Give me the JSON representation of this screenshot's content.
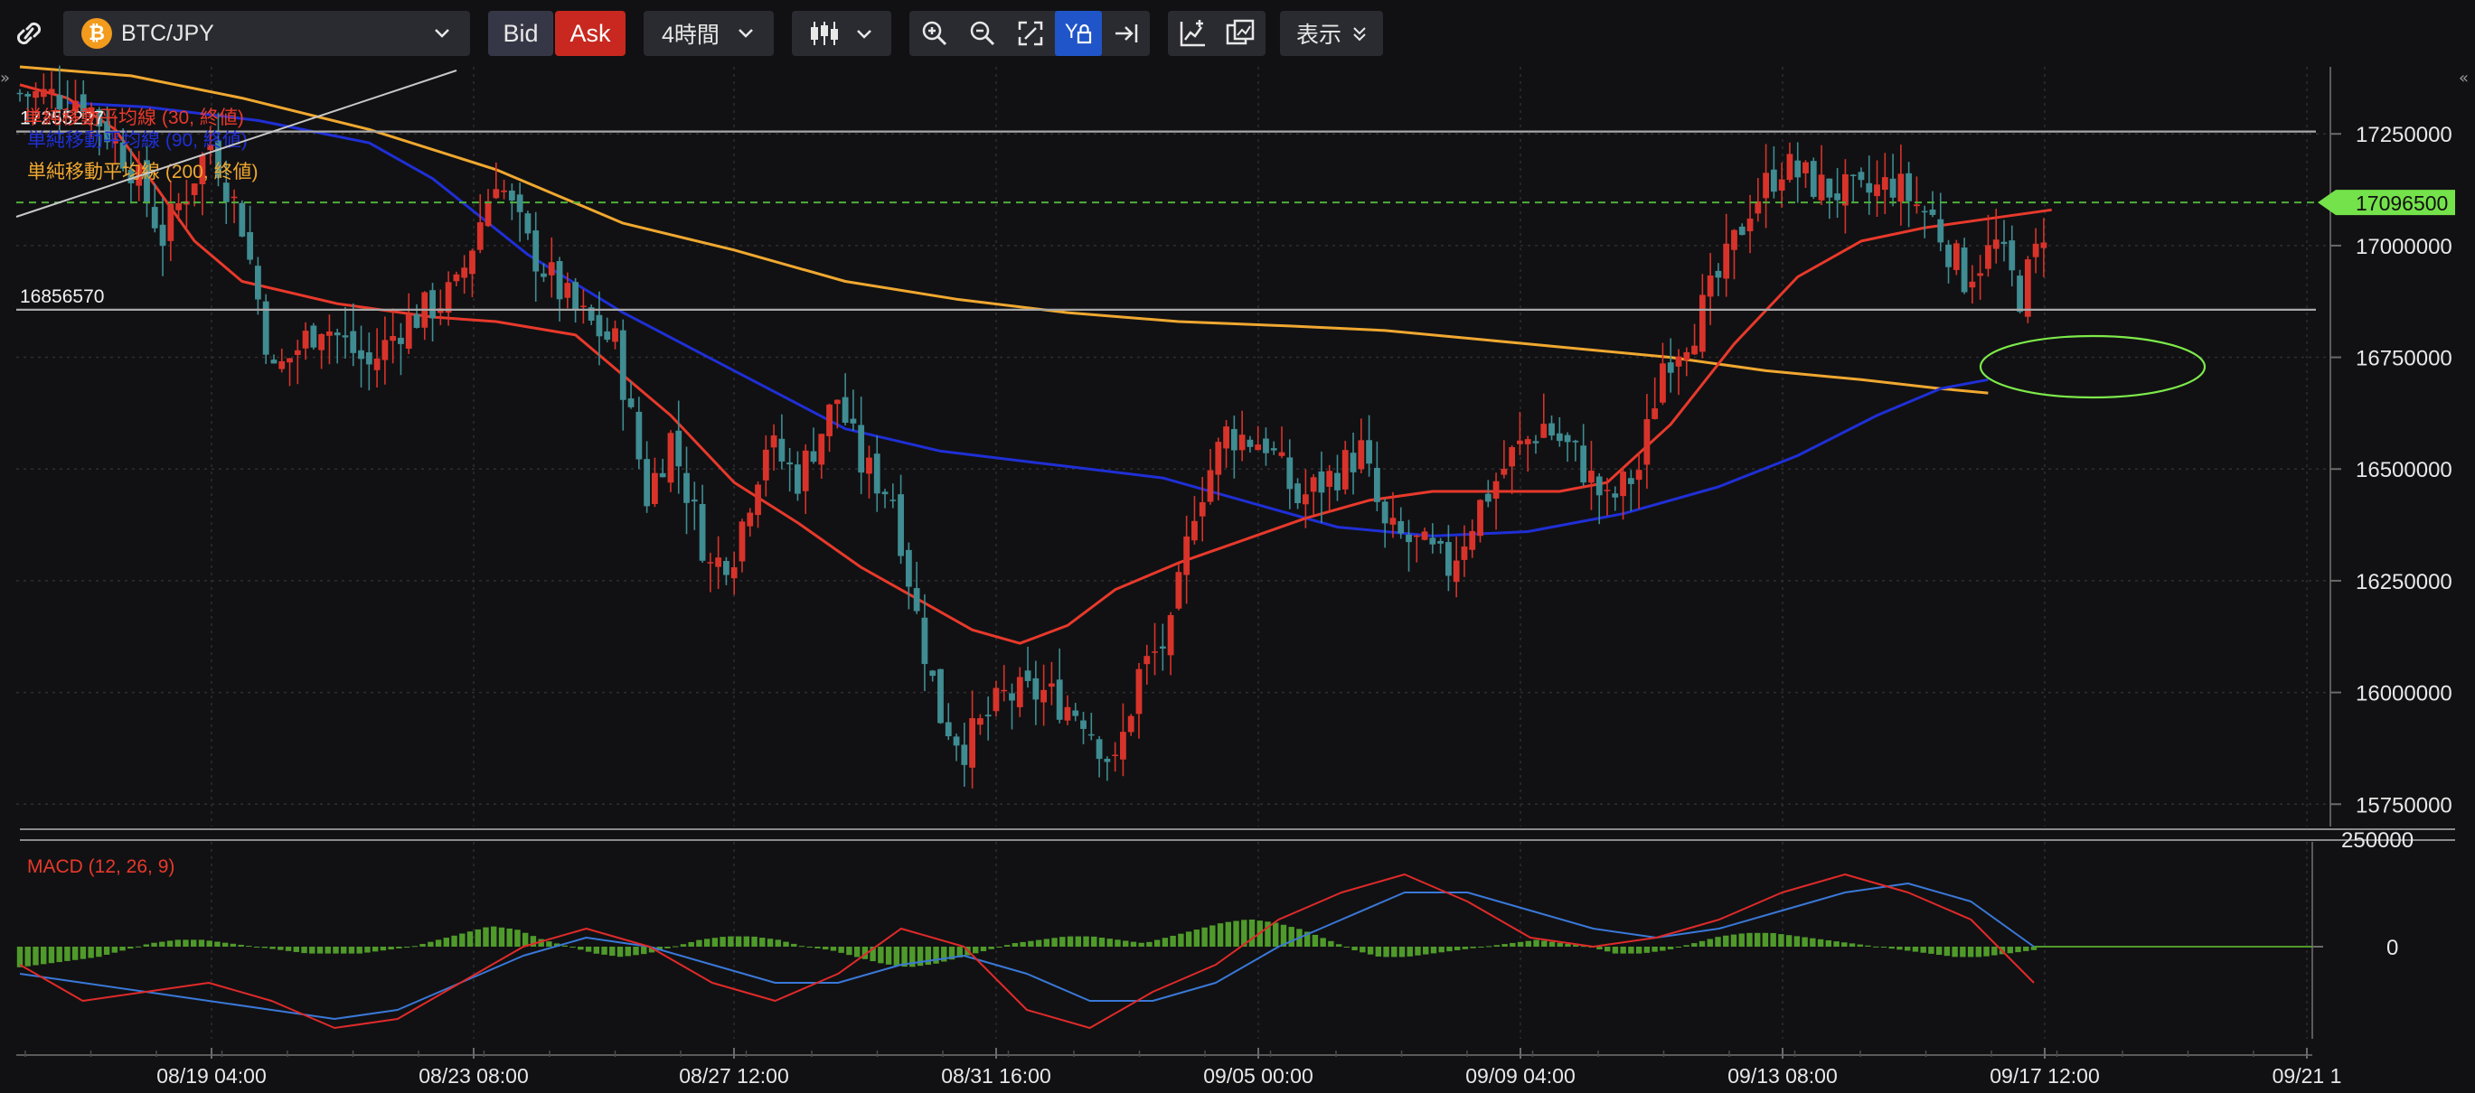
{
  "toolbar": {
    "link_icon": "link-icon",
    "symbol": "BTC/JPY",
    "symbol_coin_glyph": "₿",
    "bid_label": "Bid",
    "ask_label": "Ask",
    "timeframe": "4時間",
    "display_label": "表示",
    "zoom_tools": [
      "zoom-in-icon",
      "zoom-out-icon",
      "fit-screen-icon",
      "y-axis-lock-icon",
      "scroll-to-latest-icon"
    ],
    "indicator_tools": [
      "add-indicator-icon",
      "chart-layout-icon"
    ],
    "active_color": "#1f55c8",
    "ask_color": "#c8281f"
  },
  "chart_data": {
    "type": "candlestick",
    "symbol": "BTC/JPY",
    "timeframe": "4時間",
    "ylim": [
      15700000,
      17400000
    ],
    "y_ticks": [
      "17250000",
      "17000000",
      "16750000",
      "16500000",
      "16250000",
      "16000000",
      "15750000"
    ],
    "y_tick_values": [
      17250000,
      17000000,
      16750000,
      16500000,
      16250000,
      16000000,
      15750000
    ],
    "x_ticks": [
      "08/19 04:00",
      "08/23 08:00",
      "08/27 12:00",
      "08/31 16:00",
      "09/05 00:00",
      "09/09 04:00",
      "09/13 08:00",
      "09/17 12:00",
      "09/21 1"
    ],
    "current_price": "17096500",
    "current_price_value": 17096500,
    "horizontal_lines": [
      {
        "label": "17255227",
        "value": 17255227
      },
      {
        "label": "16856570",
        "value": 16856570
      }
    ],
    "legend": [
      {
        "label": "単純移動平均線 (30, 終値)",
        "color": "#e8392b"
      },
      {
        "label": "単純移動平均線 (90, 終値)",
        "color": "#1f2fd6"
      },
      {
        "label": "単純移動平均線 (200, 終値)",
        "color": "#f0a830"
      }
    ],
    "up_color": "#d8332a",
    "down_color": "#3f8c92",
    "close_path": [
      [
        0,
        17340000
      ],
      [
        8,
        17330000
      ],
      [
        14,
        17180000
      ],
      [
        18,
        17020000
      ],
      [
        24,
        17230000
      ],
      [
        28,
        17050000
      ],
      [
        32,
        16710000
      ],
      [
        38,
        16830000
      ],
      [
        44,
        16730000
      ],
      [
        48,
        16820000
      ],
      [
        55,
        16900000
      ],
      [
        60,
        17160000
      ],
      [
        64,
        17000000
      ],
      [
        70,
        16850000
      ],
      [
        75,
        16780000
      ],
      [
        79,
        16440000
      ],
      [
        82,
        16570000
      ],
      [
        87,
        16280000
      ],
      [
        90,
        16320000
      ],
      [
        94,
        16560000
      ],
      [
        98,
        16480000
      ],
      [
        103,
        16660000
      ],
      [
        106,
        16510000
      ],
      [
        110,
        16440000
      ],
      [
        113,
        16170000
      ],
      [
        116,
        15950000
      ],
      [
        119,
        15880000
      ],
      [
        124,
        15990000
      ],
      [
        129,
        16000000
      ],
      [
        134,
        15950000
      ],
      [
        138,
        15830000
      ],
      [
        141,
        16040000
      ],
      [
        145,
        16130000
      ],
      [
        148,
        16420000
      ],
      [
        152,
        16580000
      ],
      [
        157,
        16560000
      ],
      [
        161,
        16430000
      ],
      [
        165,
        16480000
      ],
      [
        169,
        16540000
      ],
      [
        172,
        16360000
      ],
      [
        176,
        16330000
      ],
      [
        180,
        16280000
      ],
      [
        184,
        16420000
      ],
      [
        188,
        16530000
      ],
      [
        192,
        16600000
      ],
      [
        196,
        16530000
      ],
      [
        200,
        16420000
      ],
      [
        204,
        16500000
      ],
      [
        207,
        16740000
      ],
      [
        211,
        16820000
      ],
      [
        215,
        16960000
      ],
      [
        218,
        17090000
      ],
      [
        222,
        17180000
      ],
      [
        227,
        17130000
      ],
      [
        232,
        17110000
      ],
      [
        236,
        17140000
      ],
      [
        241,
        17060000
      ],
      [
        245,
        16930000
      ],
      [
        249,
        17000000
      ],
      [
        252,
        16890000
      ],
      [
        254,
        16980000
      ],
      [
        256,
        17100000
      ]
    ],
    "sma30": [
      [
        0,
        17360000
      ],
      [
        6,
        17330000
      ],
      [
        12,
        17260000
      ],
      [
        16,
        17160000
      ],
      [
        22,
        17010000
      ],
      [
        28,
        16920000
      ],
      [
        40,
        16870000
      ],
      [
        52,
        16840000
      ],
      [
        60,
        16830000
      ],
      [
        70,
        16800000
      ],
      [
        82,
        16620000
      ],
      [
        90,
        16470000
      ],
      [
        98,
        16380000
      ],
      [
        106,
        16280000
      ],
      [
        114,
        16200000
      ],
      [
        120,
        16140000
      ],
      [
        126,
        16110000
      ],
      [
        132,
        16150000
      ],
      [
        138,
        16230000
      ],
      [
        146,
        16290000
      ],
      [
        154,
        16340000
      ],
      [
        162,
        16390000
      ],
      [
        170,
        16430000
      ],
      [
        178,
        16450000
      ],
      [
        186,
        16450000
      ],
      [
        194,
        16450000
      ],
      [
        200,
        16470000
      ],
      [
        208,
        16600000
      ],
      [
        216,
        16780000
      ],
      [
        224,
        16930000
      ],
      [
        232,
        17010000
      ],
      [
        240,
        17040000
      ],
      [
        248,
        17060000
      ],
      [
        256,
        17080000
      ]
    ],
    "sma90": [
      [
        6,
        17320000
      ],
      [
        16,
        17310000
      ],
      [
        30,
        17280000
      ],
      [
        44,
        17230000
      ],
      [
        52,
        17150000
      ],
      [
        64,
        16980000
      ],
      [
        76,
        16850000
      ],
      [
        90,
        16720000
      ],
      [
        104,
        16590000
      ],
      [
        116,
        16540000
      ],
      [
        130,
        16510000
      ],
      [
        144,
        16480000
      ],
      [
        156,
        16420000
      ],
      [
        166,
        16370000
      ],
      [
        178,
        16350000
      ],
      [
        190,
        16360000
      ],
      [
        202,
        16400000
      ],
      [
        214,
        16460000
      ],
      [
        224,
        16530000
      ],
      [
        234,
        16620000
      ],
      [
        242,
        16680000
      ],
      [
        248,
        16700000
      ]
    ],
    "sma200": [
      [
        0,
        17400000
      ],
      [
        14,
        17380000
      ],
      [
        28,
        17330000
      ],
      [
        44,
        17260000
      ],
      [
        60,
        17170000
      ],
      [
        76,
        17050000
      ],
      [
        90,
        16990000
      ],
      [
        104,
        16920000
      ],
      [
        118,
        16880000
      ],
      [
        132,
        16850000
      ],
      [
        146,
        16830000
      ],
      [
        160,
        16820000
      ],
      [
        172,
        16810000
      ],
      [
        184,
        16790000
      ],
      [
        196,
        16770000
      ],
      [
        208,
        16750000
      ],
      [
        220,
        16720000
      ],
      [
        232,
        16700000
      ],
      [
        242,
        16680000
      ],
      [
        248,
        16670000
      ]
    ],
    "annotation": {
      "type": "ellipse",
      "color": "#7dea4a",
      "near_value": 16720000
    }
  },
  "macd": {
    "label": "MACD (12, 26, 9)",
    "zero_tick": "0",
    "top_tick_partial": "250000",
    "histogram": [
      -0.6,
      -0.5,
      -0.4,
      -0.3,
      -0.1,
      0.1,
      0.2,
      0.2,
      0.1,
      0.0,
      -0.1,
      -0.2,
      -0.2,
      -0.2,
      -0.1,
      0.0,
      0.2,
      0.4,
      0.6,
      0.5,
      0.2,
      0.0,
      -0.2,
      -0.3,
      -0.2,
      0.0,
      0.2,
      0.3,
      0.3,
      0.2,
      0.0,
      -0.1,
      -0.3,
      -0.5,
      -0.6,
      -0.5,
      -0.3,
      -0.1,
      0.1,
      0.2,
      0.3,
      0.3,
      0.2,
      0.1,
      0.3,
      0.5,
      0.7,
      0.8,
      0.7,
      0.5,
      0.2,
      -0.1,
      -0.3,
      -0.3,
      -0.2,
      -0.1,
      0.0,
      0.1,
      0.2,
      0.1,
      0.0,
      -0.2,
      -0.2,
      -0.1,
      0.1,
      0.3,
      0.4,
      0.4,
      0.3,
      0.2,
      0.1,
      0.0,
      -0.1,
      -0.2,
      -0.3,
      -0.3,
      -0.2,
      -0.1
    ],
    "macd_line": [
      -0.2,
      -0.6,
      -0.5,
      -0.4,
      -0.6,
      -0.9,
      -0.8,
      -0.4,
      0.0,
      0.2,
      0.0,
      -0.4,
      -0.6,
      -0.3,
      0.2,
      0.0,
      -0.7,
      -0.9,
      -0.5,
      -0.2,
      0.3,
      0.6,
      0.8,
      0.5,
      0.1,
      0.0,
      0.1,
      0.3,
      0.6,
      0.8,
      0.6,
      0.3,
      -0.4
    ],
    "signal_line": [
      -0.3,
      -0.4,
      -0.5,
      -0.6,
      -0.7,
      -0.8,
      -0.7,
      -0.4,
      -0.1,
      0.1,
      0.0,
      -0.2,
      -0.4,
      -0.4,
      -0.2,
      -0.1,
      -0.3,
      -0.6,
      -0.6,
      -0.4,
      0.0,
      0.3,
      0.6,
      0.6,
      0.4,
      0.2,
      0.1,
      0.2,
      0.4,
      0.6,
      0.7,
      0.5,
      0.0
    ],
    "hist_up_color": "#4f9a2a",
    "macd_color": "#e02a2a",
    "signal_color": "#3a78d8"
  }
}
